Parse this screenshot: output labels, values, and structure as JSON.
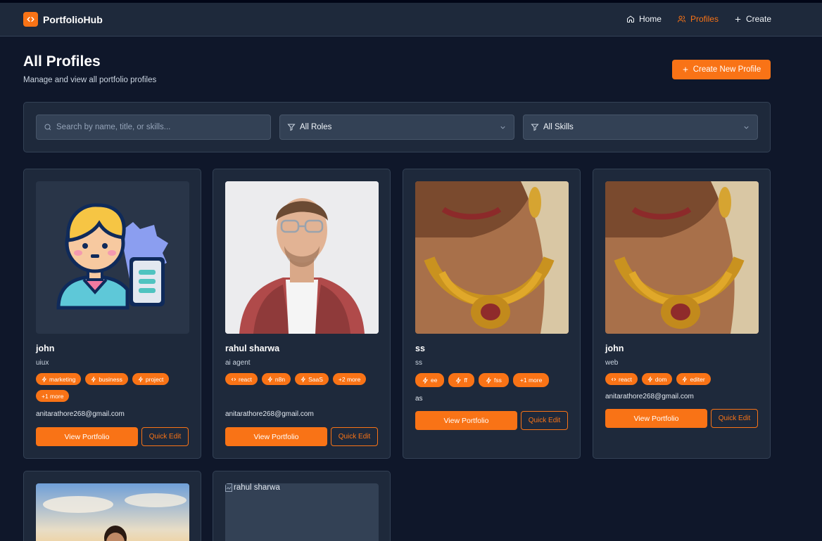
{
  "nav": {
    "brand": "PortfolioHub",
    "links": [
      {
        "label": "Home",
        "icon": "home-icon"
      },
      {
        "label": "Profiles",
        "icon": "users-icon",
        "active": true
      },
      {
        "label": "Create",
        "icon": "plus-icon"
      }
    ]
  },
  "header": {
    "title": "All Profiles",
    "subtitle": "Manage and view all portfolio profiles",
    "create_label": "Create New Profile"
  },
  "filters": {
    "search_placeholder": "Search by name, title, or skills...",
    "roles_selected": "All Roles",
    "skills_selected": "All Skills"
  },
  "profiles": [
    {
      "name": "john",
      "role": "uiux",
      "tags": [
        "marketing",
        "business",
        "project"
      ],
      "more": "+1 more",
      "email": "anitarathore268@gmail.com",
      "view_label": "View Portfolio",
      "edit_label": "Quick Edit"
    },
    {
      "name": "rahul sharwa",
      "role": "ai agent",
      "tags": [
        "react",
        "n8n",
        "SaaS"
      ],
      "more": "+2 more",
      "email": "anitarathore268@gmail.com",
      "view_label": "View Portfolio",
      "edit_label": "Quick Edit"
    },
    {
      "name": "ss",
      "role": "ss",
      "tags": [
        "ee",
        "ff",
        "fss"
      ],
      "more": "+1 more",
      "email": "as",
      "view_label": "View Portfolio",
      "edit_label": "Quick Edit"
    },
    {
      "name": "john",
      "role": "web",
      "tags": [
        "react",
        "dom",
        "editer"
      ],
      "more": "",
      "email": "anitarathore268@gmail.com",
      "view_label": "View Portfolio",
      "edit_label": "Quick Edit"
    },
    {
      "name": "",
      "role": "",
      "tags": [],
      "more": "",
      "email": "",
      "view_label": "",
      "edit_label": ""
    },
    {
      "name": "",
      "role": "",
      "tags": [],
      "more": "",
      "email": "",
      "view_label": "",
      "edit_label": "",
      "image_alt": "rahul sharwa"
    }
  ],
  "colors": {
    "accent": "#f97316",
    "background": "#0f172a",
    "panel": "#1e293b",
    "field": "#334155"
  }
}
